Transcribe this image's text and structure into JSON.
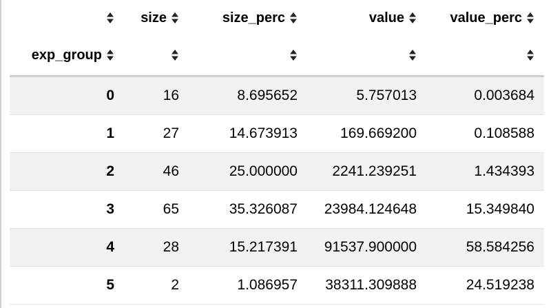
{
  "table": {
    "columns": [
      "",
      "size",
      "size_perc",
      "value",
      "value_perc"
    ],
    "index_name": "exp_group",
    "sort_icon": "sort-icon",
    "rows": [
      {
        "index": "0",
        "cells": [
          "16",
          "8.695652",
          "5.757013",
          "0.003684"
        ]
      },
      {
        "index": "1",
        "cells": [
          "27",
          "14.673913",
          "169.669200",
          "0.108588"
        ]
      },
      {
        "index": "2",
        "cells": [
          "46",
          "25.000000",
          "2241.239251",
          "1.434393"
        ]
      },
      {
        "index": "3",
        "cells": [
          "65",
          "35.326087",
          "23984.124648",
          "15.349840"
        ]
      },
      {
        "index": "4",
        "cells": [
          "28",
          "15.217391",
          "91537.900000",
          "58.584256"
        ]
      },
      {
        "index": "5",
        "cells": [
          "2",
          "1.086957",
          "38311.309888",
          "24.519238"
        ]
      }
    ]
  },
  "colors": {
    "striped_row": "#f2f2f2",
    "header_rule": "#cfcfcf",
    "row_rule": "#e4e4e4"
  }
}
